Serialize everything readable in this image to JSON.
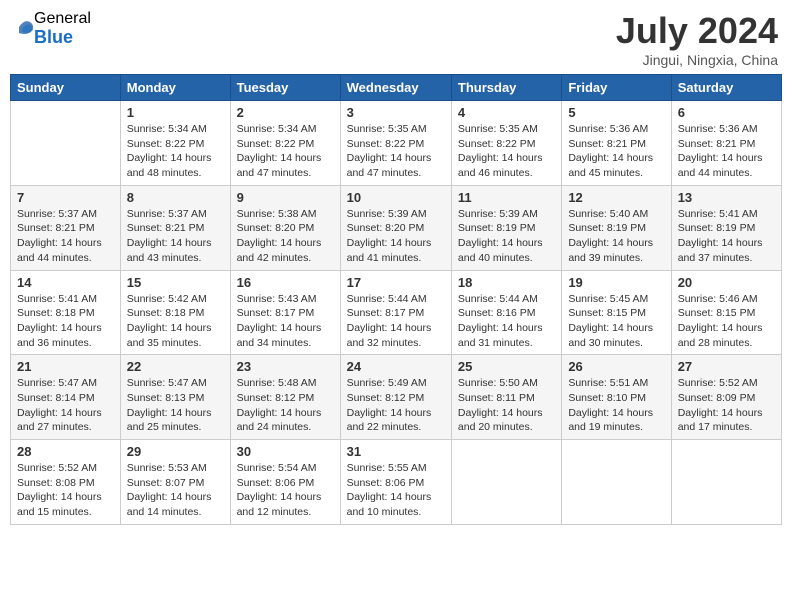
{
  "logo": {
    "general": "General",
    "blue": "Blue"
  },
  "title": {
    "month_year": "July 2024",
    "location": "Jingui, Ningxia, China"
  },
  "weekdays": [
    "Sunday",
    "Monday",
    "Tuesday",
    "Wednesday",
    "Thursday",
    "Friday",
    "Saturday"
  ],
  "weeks": [
    [
      {
        "day": "",
        "info": ""
      },
      {
        "day": "1",
        "info": "Sunrise: 5:34 AM\nSunset: 8:22 PM\nDaylight: 14 hours\nand 48 minutes."
      },
      {
        "day": "2",
        "info": "Sunrise: 5:34 AM\nSunset: 8:22 PM\nDaylight: 14 hours\nand 47 minutes."
      },
      {
        "day": "3",
        "info": "Sunrise: 5:35 AM\nSunset: 8:22 PM\nDaylight: 14 hours\nand 47 minutes."
      },
      {
        "day": "4",
        "info": "Sunrise: 5:35 AM\nSunset: 8:22 PM\nDaylight: 14 hours\nand 46 minutes."
      },
      {
        "day": "5",
        "info": "Sunrise: 5:36 AM\nSunset: 8:21 PM\nDaylight: 14 hours\nand 45 minutes."
      },
      {
        "day": "6",
        "info": "Sunrise: 5:36 AM\nSunset: 8:21 PM\nDaylight: 14 hours\nand 44 minutes."
      }
    ],
    [
      {
        "day": "7",
        "info": "Sunrise: 5:37 AM\nSunset: 8:21 PM\nDaylight: 14 hours\nand 44 minutes."
      },
      {
        "day": "8",
        "info": "Sunrise: 5:37 AM\nSunset: 8:21 PM\nDaylight: 14 hours\nand 43 minutes."
      },
      {
        "day": "9",
        "info": "Sunrise: 5:38 AM\nSunset: 8:20 PM\nDaylight: 14 hours\nand 42 minutes."
      },
      {
        "day": "10",
        "info": "Sunrise: 5:39 AM\nSunset: 8:20 PM\nDaylight: 14 hours\nand 41 minutes."
      },
      {
        "day": "11",
        "info": "Sunrise: 5:39 AM\nSunset: 8:19 PM\nDaylight: 14 hours\nand 40 minutes."
      },
      {
        "day": "12",
        "info": "Sunrise: 5:40 AM\nSunset: 8:19 PM\nDaylight: 14 hours\nand 39 minutes."
      },
      {
        "day": "13",
        "info": "Sunrise: 5:41 AM\nSunset: 8:19 PM\nDaylight: 14 hours\nand 37 minutes."
      }
    ],
    [
      {
        "day": "14",
        "info": "Sunrise: 5:41 AM\nSunset: 8:18 PM\nDaylight: 14 hours\nand 36 minutes."
      },
      {
        "day": "15",
        "info": "Sunrise: 5:42 AM\nSunset: 8:18 PM\nDaylight: 14 hours\nand 35 minutes."
      },
      {
        "day": "16",
        "info": "Sunrise: 5:43 AM\nSunset: 8:17 PM\nDaylight: 14 hours\nand 34 minutes."
      },
      {
        "day": "17",
        "info": "Sunrise: 5:44 AM\nSunset: 8:17 PM\nDaylight: 14 hours\nand 32 minutes."
      },
      {
        "day": "18",
        "info": "Sunrise: 5:44 AM\nSunset: 8:16 PM\nDaylight: 14 hours\nand 31 minutes."
      },
      {
        "day": "19",
        "info": "Sunrise: 5:45 AM\nSunset: 8:15 PM\nDaylight: 14 hours\nand 30 minutes."
      },
      {
        "day": "20",
        "info": "Sunrise: 5:46 AM\nSunset: 8:15 PM\nDaylight: 14 hours\nand 28 minutes."
      }
    ],
    [
      {
        "day": "21",
        "info": "Sunrise: 5:47 AM\nSunset: 8:14 PM\nDaylight: 14 hours\nand 27 minutes."
      },
      {
        "day": "22",
        "info": "Sunrise: 5:47 AM\nSunset: 8:13 PM\nDaylight: 14 hours\nand 25 minutes."
      },
      {
        "day": "23",
        "info": "Sunrise: 5:48 AM\nSunset: 8:12 PM\nDaylight: 14 hours\nand 24 minutes."
      },
      {
        "day": "24",
        "info": "Sunrise: 5:49 AM\nSunset: 8:12 PM\nDaylight: 14 hours\nand 22 minutes."
      },
      {
        "day": "25",
        "info": "Sunrise: 5:50 AM\nSunset: 8:11 PM\nDaylight: 14 hours\nand 20 minutes."
      },
      {
        "day": "26",
        "info": "Sunrise: 5:51 AM\nSunset: 8:10 PM\nDaylight: 14 hours\nand 19 minutes."
      },
      {
        "day": "27",
        "info": "Sunrise: 5:52 AM\nSunset: 8:09 PM\nDaylight: 14 hours\nand 17 minutes."
      }
    ],
    [
      {
        "day": "28",
        "info": "Sunrise: 5:52 AM\nSunset: 8:08 PM\nDaylight: 14 hours\nand 15 minutes."
      },
      {
        "day": "29",
        "info": "Sunrise: 5:53 AM\nSunset: 8:07 PM\nDaylight: 14 hours\nand 14 minutes."
      },
      {
        "day": "30",
        "info": "Sunrise: 5:54 AM\nSunset: 8:06 PM\nDaylight: 14 hours\nand 12 minutes."
      },
      {
        "day": "31",
        "info": "Sunrise: 5:55 AM\nSunset: 8:06 PM\nDaylight: 14 hours\nand 10 minutes."
      },
      {
        "day": "",
        "info": ""
      },
      {
        "day": "",
        "info": ""
      },
      {
        "day": "",
        "info": ""
      }
    ]
  ]
}
